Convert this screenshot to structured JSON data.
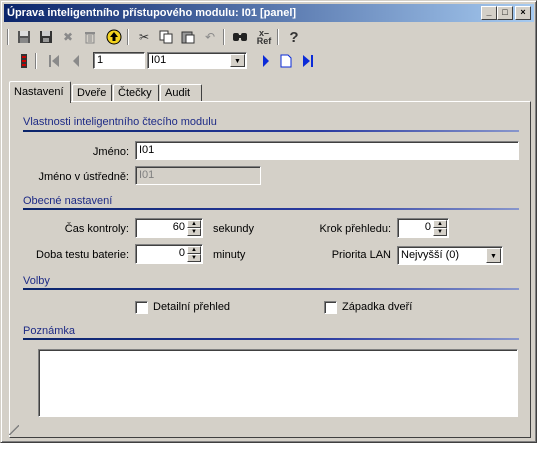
{
  "window": {
    "title": "Úprava inteligentního přístupového modulu: I01 [panel]",
    "controls": {
      "minimize": "_",
      "maximize": "□",
      "close": "×"
    }
  },
  "toolbar": {
    "icons": [
      "save-icon",
      "save-close-icon",
      "delete-x-icon",
      "trash-icon",
      "up-arrow-icon",
      "cut-icon",
      "copy-icon",
      "paste-icon",
      "undo-icon",
      "find-icon",
      "ref-icon",
      "help-icon"
    ],
    "ref_label": "x–\nRef",
    "help_label": "?"
  },
  "navigator": {
    "record_number": "1",
    "record_select": "I01"
  },
  "tabs": [
    {
      "label": "Nastavení",
      "active": true
    },
    {
      "label": "Dveře"
    },
    {
      "label": "Čtečky"
    },
    {
      "label": "Audit"
    }
  ],
  "sections": {
    "reader_props": "Vlastnosti inteligentního čtecího modulu",
    "general": "Obecné nastavení",
    "options": "Volby",
    "note": "Poznámka"
  },
  "fields": {
    "name_label": "Jméno:",
    "name_value": "I01",
    "central_name_label": "Jméno v ústředně:",
    "central_name_value": "I01",
    "check_time_label": "Čas kontroly:",
    "check_time_value": "60",
    "check_time_unit": "sekundy",
    "battery_test_label": "Doba testu baterie:",
    "battery_test_value": "0",
    "battery_test_unit": "minuty",
    "survey_step_label": "Krok přehledu:",
    "survey_step_value": "0",
    "lan_priority_label": "Priorita LAN",
    "lan_priority_value": "Nejvyšší (0)"
  },
  "options": {
    "detail_label": "Detailní přehled",
    "detail_checked": false,
    "latch_label": "Západka dveří",
    "latch_checked": false
  },
  "colors": {
    "title_gradient_start": "#0a246a",
    "section_text": "#1e2b86",
    "face": "#d4d0c8"
  }
}
